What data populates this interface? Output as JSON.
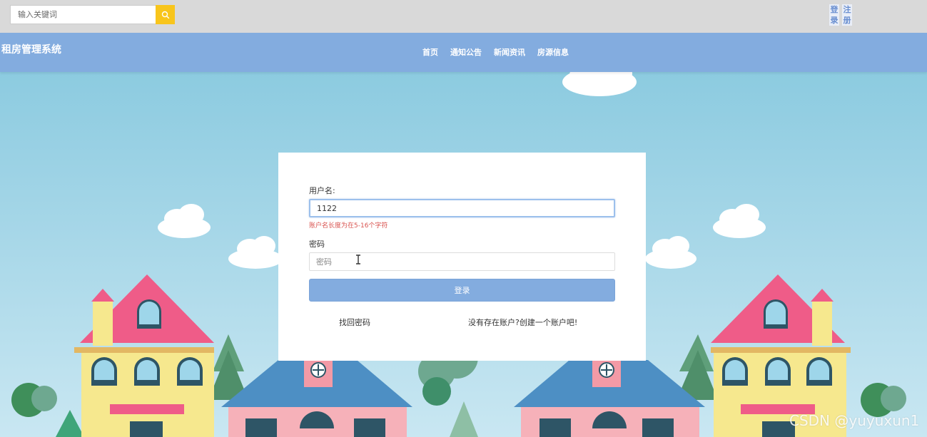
{
  "search": {
    "placeholder": "输入关键词",
    "button_icon": "search-icon"
  },
  "auth": {
    "login": "登录",
    "register": "注册"
  },
  "header": {
    "site_title": "租房管理系统",
    "nav": [
      "首页",
      "通知公告",
      "新闻资讯",
      "房源信息"
    ]
  },
  "form": {
    "username_label": "用户名:",
    "username_value": "1122",
    "username_error": "账户名长度为在5-16个字符",
    "password_label": "密码",
    "password_placeholder": "密码",
    "login_button": "登录",
    "forgot_link": "找回密码",
    "register_link": "没有存在账户?创建一个账户吧!"
  },
  "watermark": "CSDN @yuyuxun1",
  "colors": {
    "header": "#83acdf",
    "topbar": "#d9d9d9",
    "search_button": "#f8c51c",
    "error": "#d9534f"
  }
}
